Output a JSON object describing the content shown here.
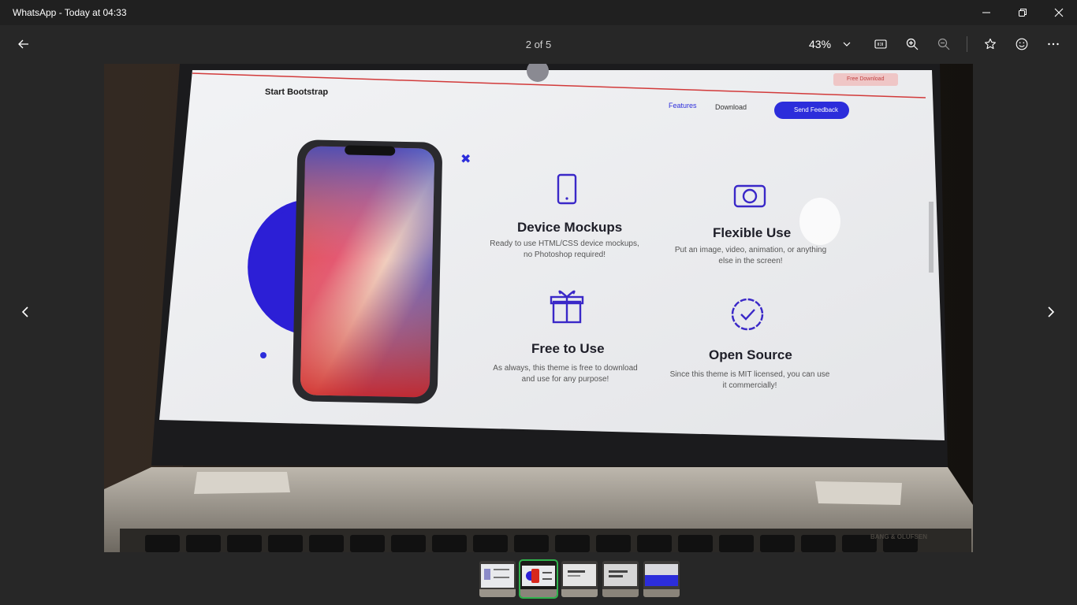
{
  "window": {
    "title": "WhatsApp - Today at 04:33"
  },
  "toolbar": {
    "counter": "2 of 5",
    "zoom_level": "43%"
  },
  "photo": {
    "brand": "Start Bootstrap",
    "nav_features": "Features",
    "nav_download": "Download",
    "send_feedback": "Send Feedback",
    "free_download": "Free Download",
    "features": [
      {
        "title": "Device Mockups",
        "line1": "Ready to use HTML/CSS device mockups,",
        "line2": "no Photoshop required!"
      },
      {
        "title": "Flexible Use",
        "line1": "Put an image, video, animation, or anything",
        "line2": "else in the screen!"
      },
      {
        "title": "Free to Use",
        "line1": "As always, this theme is free to download",
        "line2": "and use for any purpose!"
      },
      {
        "title": "Open Source",
        "line1": "Since this theme is MIT licensed, you can use",
        "line2": "it commercially!"
      }
    ],
    "speaker_brand": "BANG & OLUFSEN"
  },
  "filmstrip": {
    "count": 5,
    "selected_index": 1
  },
  "colors": {
    "background": "#272727",
    "titlebar": "#202020",
    "accent_green": "#2fb24c",
    "bootstrap_blue": "#2c2ddb"
  },
  "icons": {
    "back": "arrow-left-icon",
    "actual_size": "actual-size-icon",
    "zoom_in": "zoom-in-icon",
    "zoom_out": "zoom-out-icon",
    "favorite": "star-icon",
    "reaction": "smiley-icon",
    "more": "more-icon"
  }
}
